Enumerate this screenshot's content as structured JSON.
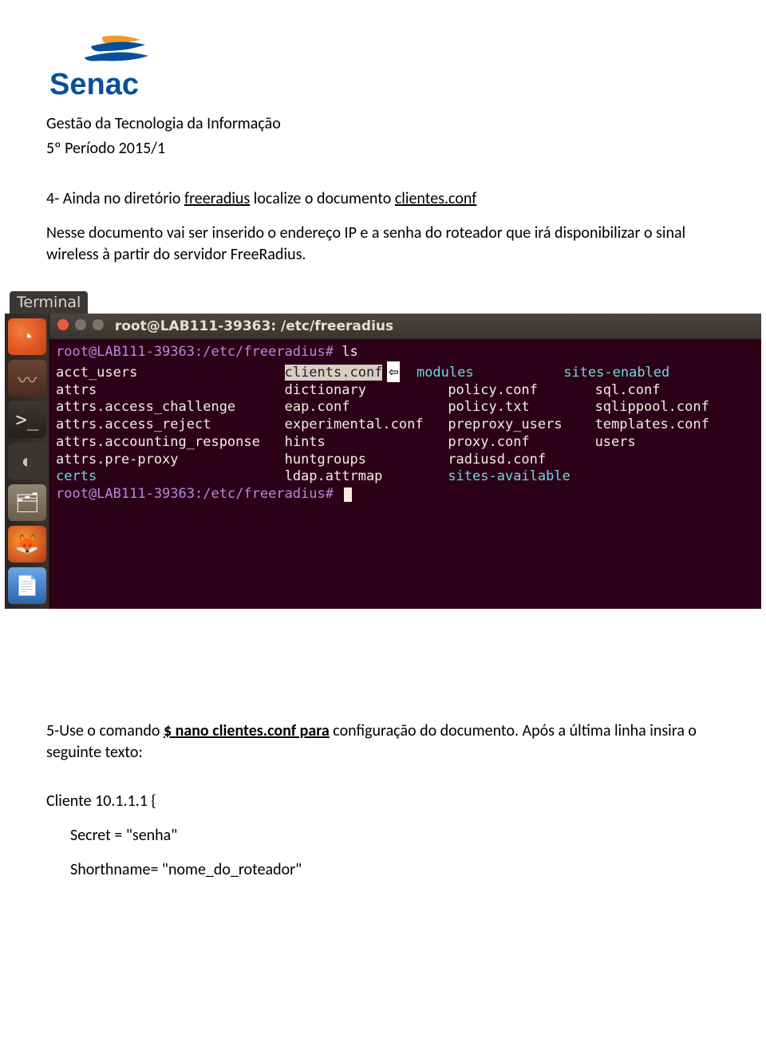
{
  "header": {
    "logo_text": "Senac",
    "line1": "Gestão da Tecnologia da Informação",
    "line2": "5º Período 2015/1"
  },
  "s4": {
    "pre": "4- Ainda no diretório ",
    "u1": "freeradius",
    "mid": " localize o documento ",
    "u2": "clientes.conf",
    "para": "Nesse documento vai ser inserido o endereço  IP e a senha do roteador que irá disponibilizar o sinal wireless à partir do servidor FreeRadius."
  },
  "terminal": {
    "top_label": "Terminal",
    "title": "root@LAB111-39363: /etc/freeradius",
    "prompt1": "root@LAB111-39363:/etc/freeradius#",
    "cmd1": "ls",
    "prompt2": "root@LAB111-39363:/etc/freeradius#",
    "files": {
      "col1": [
        "acct_users",
        "attrs",
        "attrs.access_challenge",
        "attrs.access_reject",
        "attrs.accounting_response",
        "attrs.pre-proxy",
        "certs"
      ],
      "col2": [
        "clients.conf",
        "dictionary",
        "eap.conf",
        "experimental.conf",
        "hints",
        "huntgroups",
        "ldap.attrmap"
      ],
      "col3": [
        "modules",
        "policy.conf",
        "policy.txt",
        "preproxy_users",
        "proxy.conf",
        "radiusd.conf",
        "sites-available"
      ],
      "col4": [
        "sites-enabled",
        "sql.conf",
        "sqlippool.conf",
        "templates.conf",
        "users",
        "",
        ""
      ]
    }
  },
  "s5": {
    "pre": "5-Use o comando ",
    "u1": "$ nano clientes.conf  para",
    "post": " configuração do documento. Após a última linha insira o seguinte texto:"
  },
  "code": {
    "line1": "Cliente 10.1.1.1 {",
    "line2": "Secret = \"senha\"",
    "line3": "Shorthname= \"nome_do_roteador\""
  }
}
